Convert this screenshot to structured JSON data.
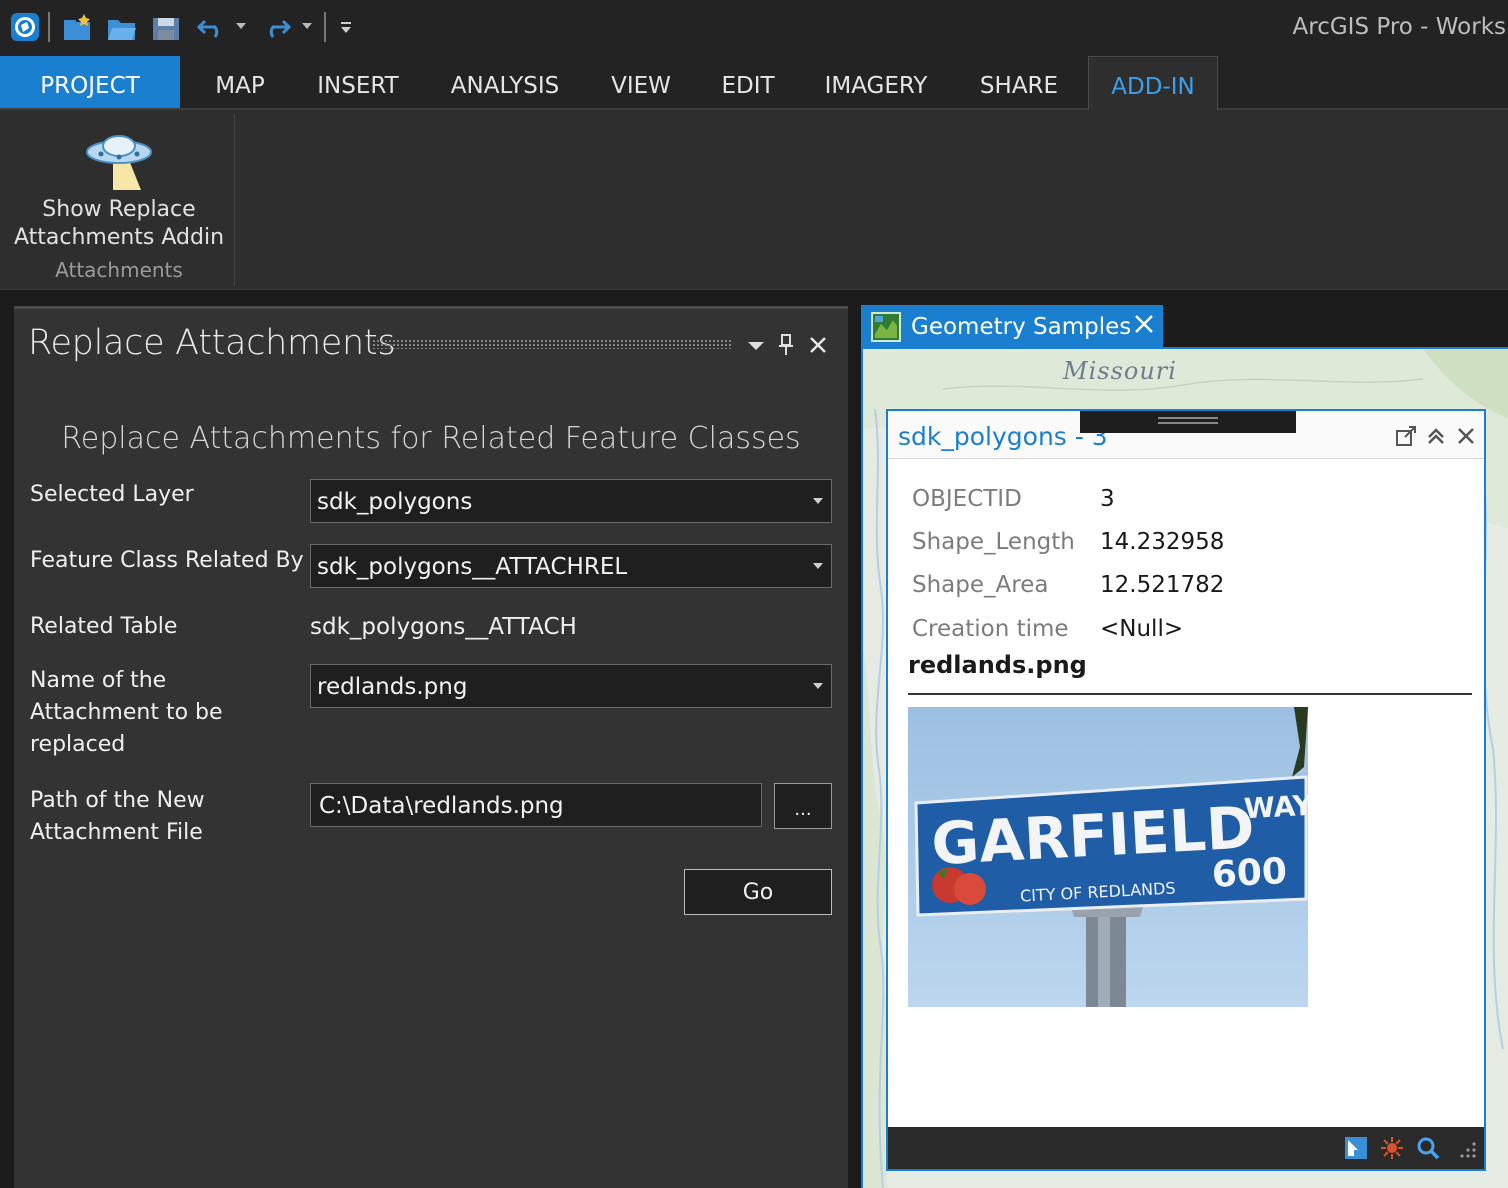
{
  "app": {
    "title": "ArcGIS Pro - Works"
  },
  "ribbon": {
    "tabs": [
      "PROJECT",
      "MAP",
      "INSERT",
      "ANALYSIS",
      "VIEW",
      "EDIT",
      "IMAGERY",
      "SHARE",
      "ADD-IN"
    ],
    "active_tab": "ADD-IN",
    "addin_button_label": "Show Replace Attachments Addin",
    "group_label": "Attachments"
  },
  "pane": {
    "title": "Replace Attachments",
    "heading": "Replace Attachments for Related Feature Classes",
    "selected_layer_label": "Selected Layer",
    "selected_layer_value": "sdk_polygons",
    "related_by_label": "Feature Class Related By",
    "related_by_value": "sdk_polygons__ATTACHREL",
    "related_table_label": "Related Table",
    "related_table_value": "sdk_polygons__ATTACH",
    "attachment_name_label": "Name of the Attachment to be replaced",
    "attachment_name_value": "redlands.png",
    "new_path_label": "Path of the New Attachment File",
    "new_path_value": "C:\\Data\\redlands.png",
    "browse_label": "...",
    "go_label": "Go"
  },
  "map": {
    "tab_label": "Geometry Samples",
    "place_label": "Missouri",
    "popup": {
      "title": "sdk_polygons - 3",
      "attributes": [
        {
          "key": "OBJECTID",
          "value": "3"
        },
        {
          "key": "Shape_Length",
          "value": "14.232958"
        },
        {
          "key": "Shape_Area",
          "value": "12.521782"
        },
        {
          "key": "Creation time",
          "value": "<Null>"
        }
      ],
      "attachment_name": "redlands.png",
      "sign_text_main": "GARFIELD",
      "sign_text_way": "WAY",
      "sign_text_city": "CITY OF REDLANDS",
      "sign_text_number": "600"
    }
  },
  "colors": {
    "accent": "#1b7fcf",
    "chrome_dark": "#232323",
    "pane_bg": "#333333"
  }
}
